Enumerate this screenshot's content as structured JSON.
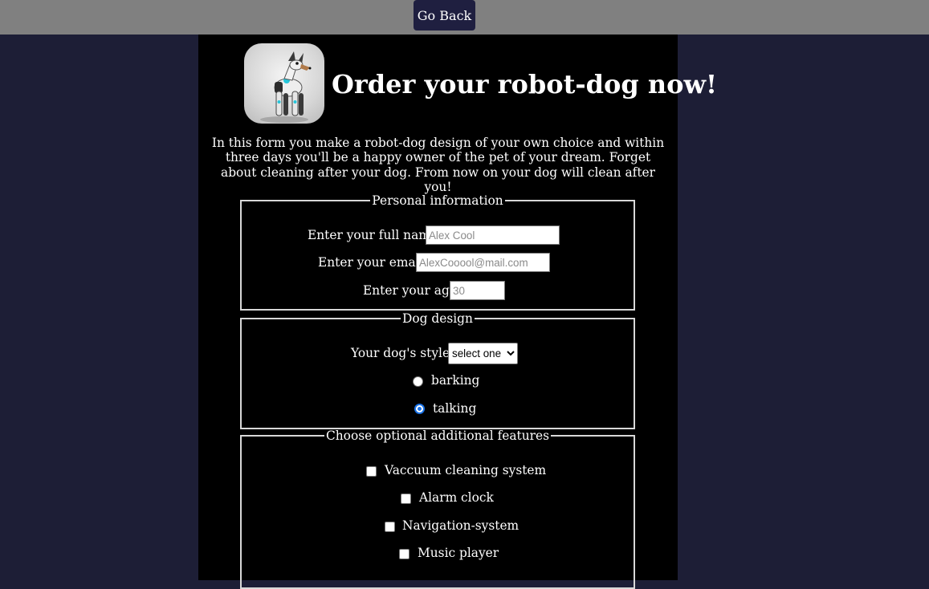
{
  "topbar": {
    "go_back_label": "Go Back"
  },
  "header": {
    "title": "Order your robot-dog now!",
    "logo_icon": "robot-dog-logo-icon"
  },
  "intro": {
    "text": "In this form you make a robot-dog design of your own choice and within three days you'll be a happy owner of the pet of your dream. Forget about cleaning after your dog. From now on your dog will clean after you!"
  },
  "personal": {
    "legend": "Personal information",
    "name_label": "Enter your full name:",
    "name_placeholder": "Alex Cool",
    "email_label": "Enter your email:",
    "email_placeholder": "AlexCooool@mail.com",
    "age_label": "Enter your age:",
    "age_placeholder": "30"
  },
  "design": {
    "legend": "Dog design",
    "style_label": "Your dog's style:",
    "style_selected": "select one",
    "voice_options": [
      {
        "label": "barking",
        "checked": false
      },
      {
        "label": "talking",
        "checked": true
      }
    ]
  },
  "features": {
    "legend": "Choose optional additional features",
    "items": [
      {
        "label": "Vaccuum cleaning system",
        "checked": false
      },
      {
        "label": "Alarm clock",
        "checked": false
      },
      {
        "label": "Navigation-system",
        "checked": false
      },
      {
        "label": "Music player",
        "checked": false
      }
    ]
  },
  "colors": {
    "page_bg": "#1d1e36",
    "topbar_bg": "#808080",
    "button_bg": "#1f1f40",
    "panel_bg": "#000000",
    "radio_accent": "#1a73e8"
  }
}
